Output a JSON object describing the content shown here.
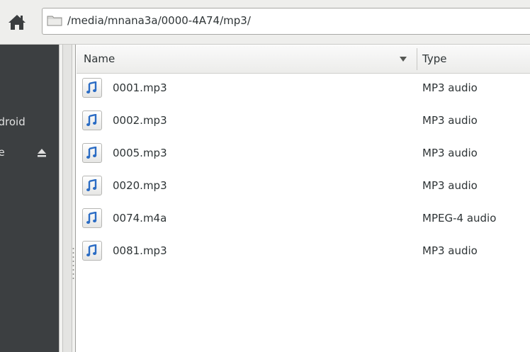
{
  "toolbar": {
    "path": "/media/mnana3a/0000-4A74/mp3/"
  },
  "sidebar": {
    "items": [
      {
        "label": "ndroid"
      },
      {
        "label": "ne"
      }
    ]
  },
  "columns": {
    "name": "Name",
    "type": "Type"
  },
  "files": [
    {
      "name": "0001.mp3",
      "type": "MP3 audio"
    },
    {
      "name": "0002.mp3",
      "type": "MP3 audio"
    },
    {
      "name": "0005.mp3",
      "type": "MP3 audio"
    },
    {
      "name": "0020.mp3",
      "type": "MP3 audio"
    },
    {
      "name": "0074.m4a",
      "type": "MPEG-4 audio"
    },
    {
      "name": "0081.mp3",
      "type": "MP3 audio"
    }
  ]
}
